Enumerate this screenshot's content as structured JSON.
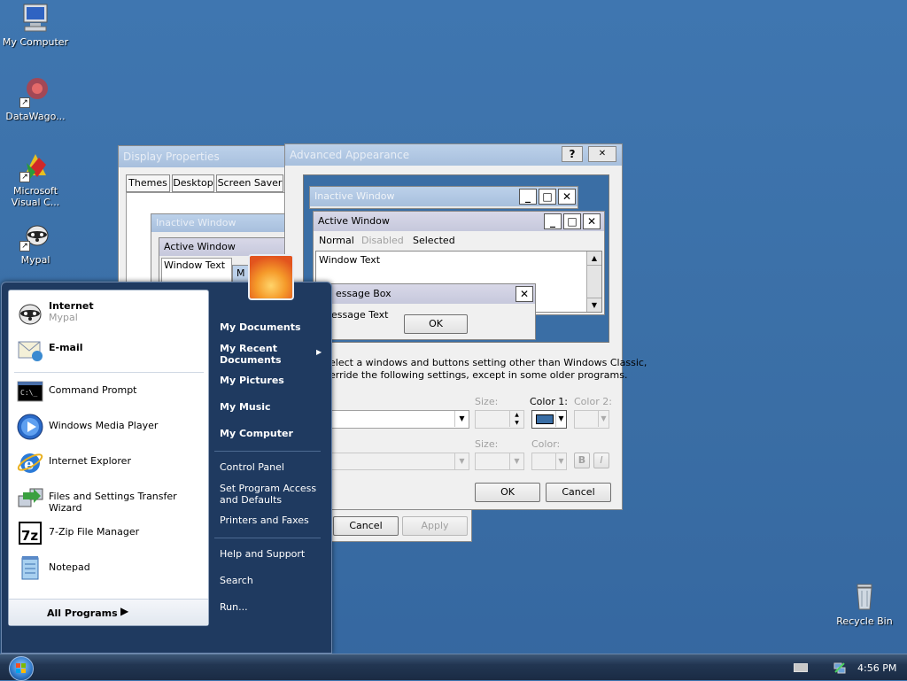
{
  "desktop": {
    "icons": [
      {
        "label": "My Computer",
        "icon": "computer-icon"
      },
      {
        "label": "DataWago...",
        "icon": "datawago-shortcut-icon"
      },
      {
        "label": "Microsoft Visual C...",
        "icon": "visual-c-shortcut-icon"
      },
      {
        "label": "Mypal",
        "icon": "mypal-shortcut-icon"
      },
      {
        "label": "Recycle Bin",
        "icon": "recycle-bin-icon"
      }
    ]
  },
  "display_properties": {
    "title": "Display Properties",
    "tabs": [
      "Themes",
      "Desktop",
      "Screen Saver"
    ],
    "preview": {
      "inactive": "Inactive Window",
      "active": "Active Window",
      "text": "Window Text",
      "msg_fragment": "M"
    },
    "buttons": {
      "cancel": "Cancel",
      "apply": "Apply"
    }
  },
  "advanced_appearance": {
    "title": "Advanced Appearance",
    "help": "?",
    "close": "✕",
    "preview": {
      "inactive": "Inactive Window",
      "active": "Active Window",
      "menu_normal": "Normal",
      "menu_disabled": "Disabled",
      "menu_selected": "Selected",
      "window_text": "Window Text",
      "msgbox_title": "essage Box",
      "msgbox_text": "essage Text",
      "ok": "OK"
    },
    "note_line1": "elect a windows and buttons setting other than Windows Classic,",
    "note_line2": "erride the following settings, except in some older programs.",
    "labels": {
      "size": "Size:",
      "color1": "Color 1:",
      "color2": "Color 2:",
      "size2": "Size:",
      "color": "Color:"
    },
    "bold": "B",
    "italic": "I",
    "ok": "OK",
    "cancel": "Cancel",
    "accent_color": "#3a6ea5"
  },
  "start_menu": {
    "pinned": [
      {
        "title": "Internet",
        "subtitle": "Mypal",
        "icon": "mypal-icon"
      },
      {
        "title": "E-mail",
        "icon": "email-icon"
      }
    ],
    "recent": [
      {
        "label": "Command Prompt",
        "icon": "command-prompt-icon"
      },
      {
        "label": "Windows Media Player",
        "icon": "media-player-icon"
      },
      {
        "label": "Internet Explorer",
        "icon": "internet-explorer-icon"
      },
      {
        "label": "Files and Settings Transfer Wizard",
        "icon": "transfer-wizard-icon"
      },
      {
        "label": "7-Zip File Manager",
        "icon": "seven-zip-icon"
      },
      {
        "label": "Notepad",
        "icon": "notepad-icon"
      }
    ],
    "all_programs": "All Programs",
    "right": {
      "my_documents": "My Documents",
      "my_recent_documents": "My Recent Documents",
      "my_pictures": "My Pictures",
      "my_music": "My Music",
      "my_computer": "My Computer",
      "control_panel": "Control Panel",
      "set_program_access": "Set Program Access and Defaults",
      "printers": "Printers and Faxes",
      "help": "Help and Support",
      "search": "Search",
      "run": "Run..."
    }
  },
  "taskbar": {
    "clock": "4:56 PM"
  }
}
